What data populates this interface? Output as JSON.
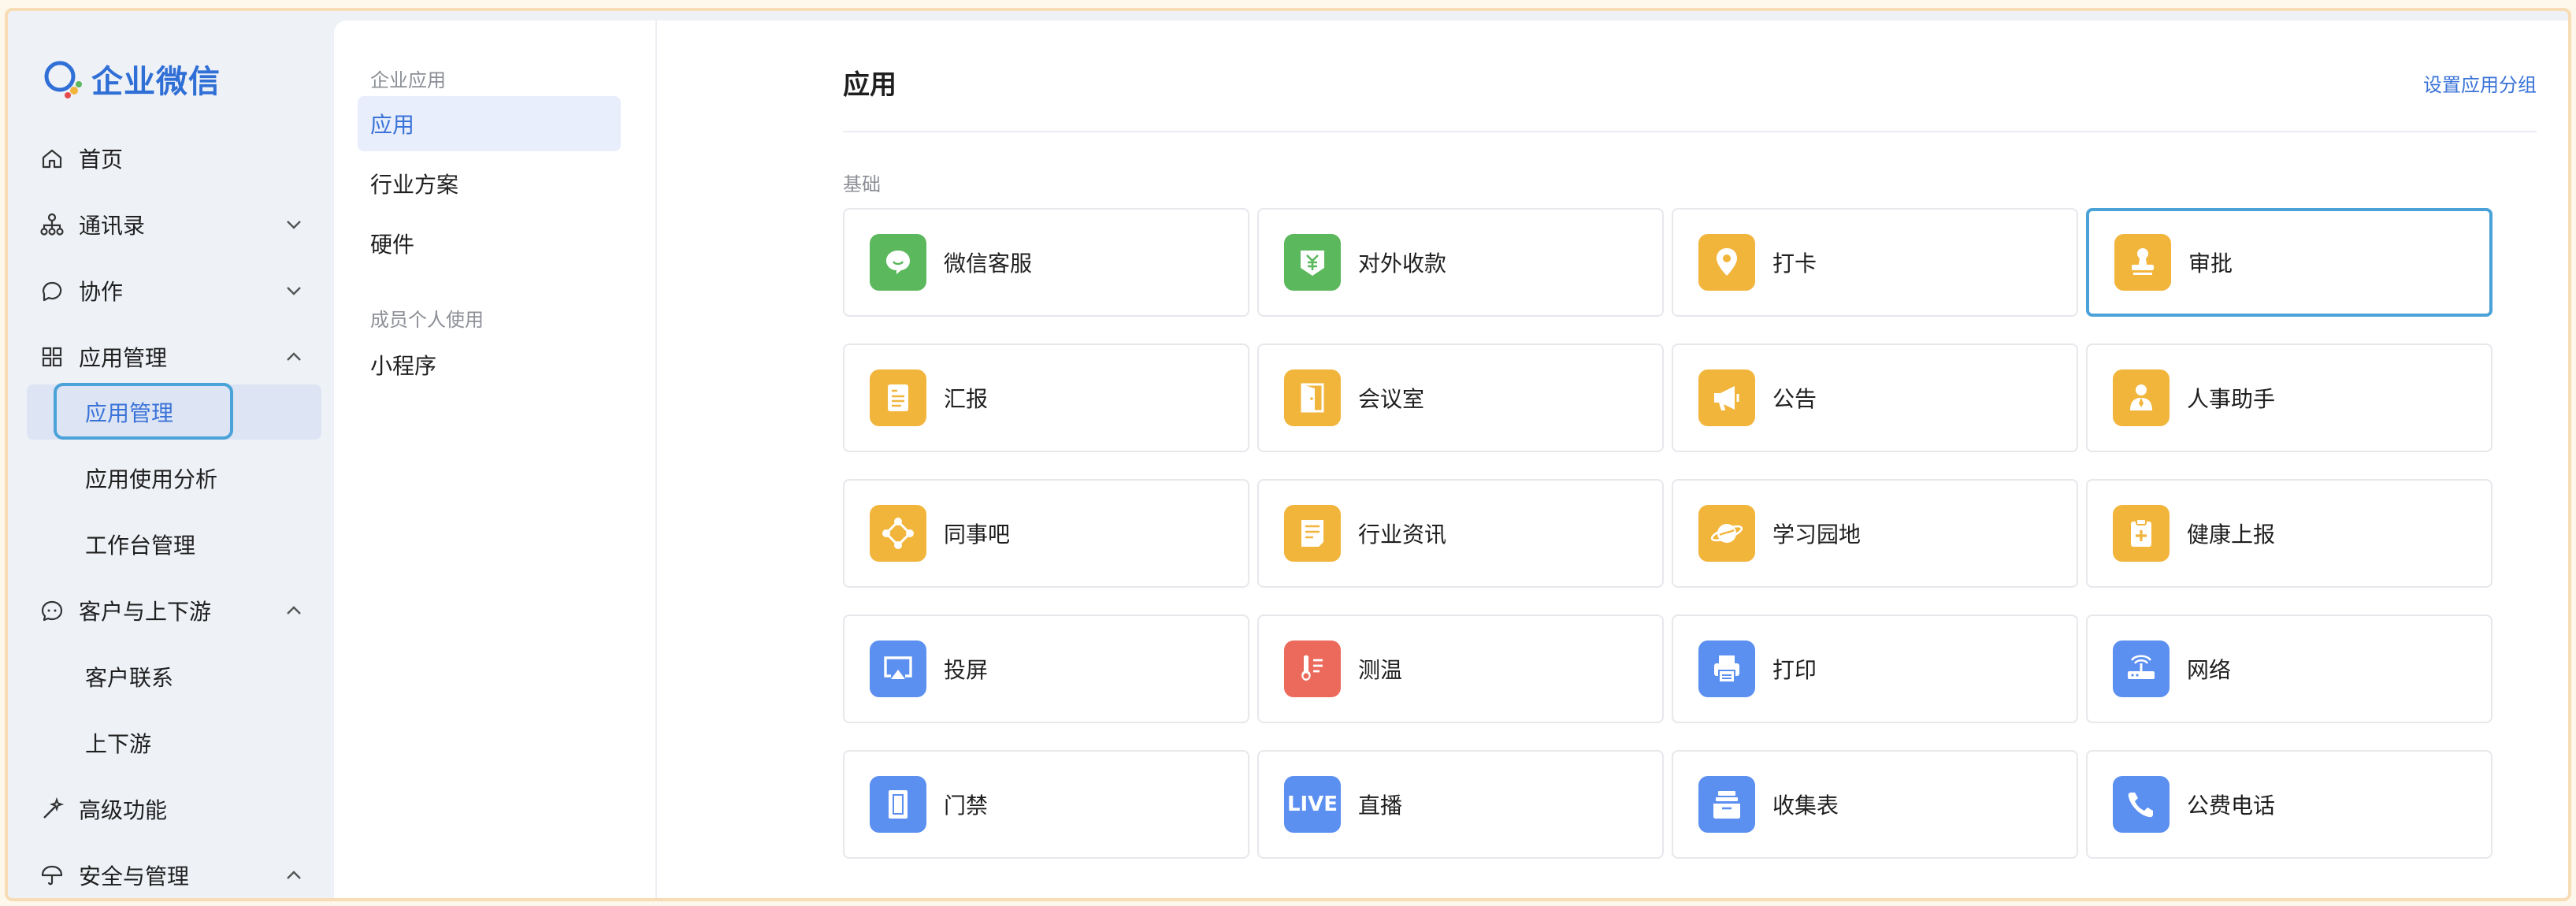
{
  "app": {
    "logo_text": "企业微信"
  },
  "nav": {
    "home": "首页",
    "contacts": "通讯录",
    "collab": "协作",
    "app_mgmt": "应用管理",
    "app_mgmt_sub": [
      "应用管理",
      "应用使用分析",
      "工作台管理"
    ],
    "customers": "客户与上下游",
    "customers_sub": [
      "客户联系",
      "上下游"
    ],
    "advanced": "高级功能",
    "security": "安全与管理"
  },
  "mid": {
    "section1": "企业应用",
    "items1": [
      "应用",
      "行业方案",
      "硬件"
    ],
    "section2": "成员个人使用",
    "items2": [
      "小程序"
    ]
  },
  "main": {
    "title": "应用",
    "group_link": "设置应用分组",
    "section": "基础",
    "apps": [
      {
        "name": "微信客服",
        "icon": "wechat-service-icon",
        "color": "#5cb85c"
      },
      {
        "name": "对外收款",
        "icon": "payment-icon",
        "color": "#5cb85c"
      },
      {
        "name": "打卡",
        "icon": "location-pin-icon",
        "color": "#f2b53c"
      },
      {
        "name": "审批",
        "icon": "stamp-icon",
        "color": "#f2b53c"
      },
      {
        "name": "汇报",
        "icon": "report-icon",
        "color": "#f2b53c"
      },
      {
        "name": "会议室",
        "icon": "door-icon",
        "color": "#f2b53c"
      },
      {
        "name": "公告",
        "icon": "megaphone-icon",
        "color": "#f2b53c"
      },
      {
        "name": "人事助手",
        "icon": "person-icon",
        "color": "#f2b53c"
      },
      {
        "name": "同事吧",
        "icon": "network-icon",
        "color": "#f2b53c"
      },
      {
        "name": "行业资讯",
        "icon": "news-icon",
        "color": "#f2b53c"
      },
      {
        "name": "学习园地",
        "icon": "planet-icon",
        "color": "#f2b53c"
      },
      {
        "name": "健康上报",
        "icon": "clipboard-plus-icon",
        "color": "#f2b53c"
      },
      {
        "name": "投屏",
        "icon": "screencast-icon",
        "color": "#5b8ff0"
      },
      {
        "name": "测温",
        "icon": "thermometer-icon",
        "color": "#ec6a5c"
      },
      {
        "name": "打印",
        "icon": "printer-icon",
        "color": "#5b8ff0"
      },
      {
        "name": "网络",
        "icon": "router-icon",
        "color": "#5b8ff0"
      },
      {
        "name": "门禁",
        "icon": "access-door-icon",
        "color": "#5b8ff0"
      },
      {
        "name": "直播",
        "icon": "live-icon",
        "color": "#5b8ff0",
        "badge": "LIVE"
      },
      {
        "name": "收集表",
        "icon": "form-box-icon",
        "color": "#5b8ff0"
      },
      {
        "name": "公费电话",
        "icon": "phone-icon",
        "color": "#5b8ff0"
      }
    ]
  },
  "colors": {
    "accent": "#3a73d8",
    "highlight": "#4aa2d8"
  }
}
